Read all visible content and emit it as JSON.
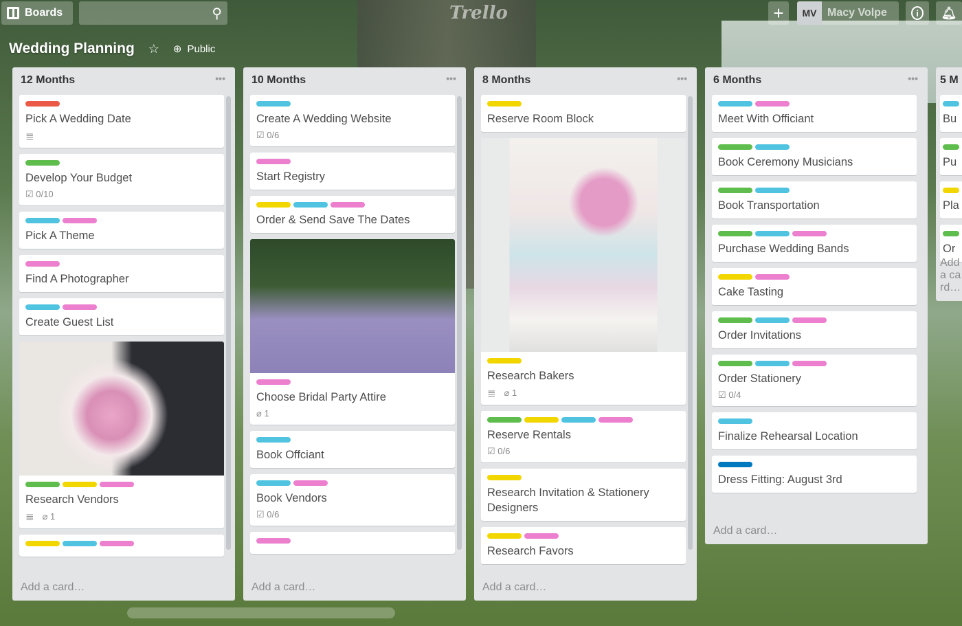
{
  "header": {
    "boards_label": "Boards",
    "logo": "Trello",
    "initials": "MV",
    "user_name": "Macy Volpe",
    "icons": [
      "boards-icon",
      "search-icon",
      "plus-icon",
      "info-icon",
      "bell-icon"
    ]
  },
  "board": {
    "title": "Wedding Planning",
    "visibility": "Public"
  },
  "label_colors": {
    "green": "#5ebd4c",
    "yellow": "#f2d600",
    "blue": "#4fc3e0",
    "pink": "#ec7fce",
    "red": "#eb5a46",
    "navy": "#0079bf"
  },
  "add_card": "Add a card…",
  "lists": [
    {
      "title": "12 Months",
      "cards": [
        {
          "labels": [
            "red"
          ],
          "title": "Pick A Wedding Date",
          "badges": {
            "description": true
          }
        },
        {
          "labels": [
            "green"
          ],
          "title": "Develop Your Budget",
          "badges": {
            "checklist": "0/10"
          }
        },
        {
          "labels": [
            "blue",
            "pink"
          ],
          "title": "Pick A Theme"
        },
        {
          "labels": [
            "pink"
          ],
          "title": "Find A Photographer"
        },
        {
          "labels": [
            "blue",
            "pink"
          ],
          "title": "Create Guest List"
        },
        {
          "cover": "bouquet",
          "labels": [
            "green",
            "yellow",
            "pink"
          ],
          "title": "Research Vendors",
          "badges": {
            "description": true,
            "attachments": "1"
          }
        },
        {
          "labels": [
            "yellow",
            "blue",
            "pink"
          ],
          "title": ""
        }
      ]
    },
    {
      "title": "10 Months",
      "cards": [
        {
          "labels": [
            "blue"
          ],
          "title": "Create A Wedding Website",
          "badges": {
            "checklist": "0/6"
          }
        },
        {
          "labels": [
            "pink"
          ],
          "title": "Start Registry"
        },
        {
          "labels": [
            "yellow",
            "blue",
            "pink"
          ],
          "title": "Order & Send Save The Dates"
        },
        {
          "cover": "bridal-party",
          "labels": [
            "pink"
          ],
          "title": "Choose Bridal Party Attire",
          "badges": {
            "attachments": "1"
          }
        },
        {
          "labels": [
            "blue"
          ],
          "title": "Book Offciant"
        },
        {
          "labels": [
            "blue",
            "pink"
          ],
          "title": "Book Vendors",
          "badges": {
            "checklist": "0/6"
          }
        },
        {
          "labels": [
            "pink"
          ],
          "title": ""
        }
      ]
    },
    {
      "title": "8 Months",
      "cards": [
        {
          "labels": [
            "yellow"
          ],
          "title": "Reserve Room Block"
        },
        {
          "cover": "cake",
          "labels": [
            "yellow"
          ],
          "title": "Research Bakers",
          "badges": {
            "description": true,
            "attachments": "1"
          }
        },
        {
          "labels": [
            "green",
            "yellow",
            "blue",
            "pink"
          ],
          "title": "Reserve Rentals",
          "badges": {
            "checklist": "0/6"
          }
        },
        {
          "labels": [
            "yellow"
          ],
          "title": "Research Invitation & Stationery Designers"
        },
        {
          "labels": [
            "yellow",
            "pink"
          ],
          "title": "Research Favors"
        }
      ]
    },
    {
      "title": "6 Months",
      "cards": [
        {
          "labels": [
            "blue",
            "pink"
          ],
          "title": "Meet With Officiant"
        },
        {
          "labels": [
            "green",
            "blue"
          ],
          "title": "Book Ceremony Musicians"
        },
        {
          "labels": [
            "green",
            "blue"
          ],
          "title": "Book Transportation"
        },
        {
          "labels": [
            "green",
            "blue",
            "pink"
          ],
          "title": "Purchase Wedding Bands"
        },
        {
          "labels": [
            "yellow",
            "pink"
          ],
          "title": "Cake Tasting"
        },
        {
          "labels": [
            "green",
            "blue",
            "pink"
          ],
          "title": "Order Invitations"
        },
        {
          "labels": [
            "green",
            "blue",
            "pink"
          ],
          "title": "Order Stationery",
          "badges": {
            "checklist": "0/4"
          }
        },
        {
          "labels": [
            "blue"
          ],
          "title": "Finalize Rehearsal Location"
        },
        {
          "labels": [
            "navy"
          ],
          "title": "Dress Fitting: August 3rd"
        }
      ]
    },
    {
      "title": "5 M",
      "cards": [
        {
          "labels": [
            "blue"
          ],
          "title": "Bu"
        },
        {
          "labels": [
            "green"
          ],
          "title": "Pu"
        },
        {
          "labels": [
            "yellow"
          ],
          "title": "Pla"
        },
        {
          "labels": [
            "green"
          ],
          "title": "Or"
        }
      ]
    }
  ]
}
